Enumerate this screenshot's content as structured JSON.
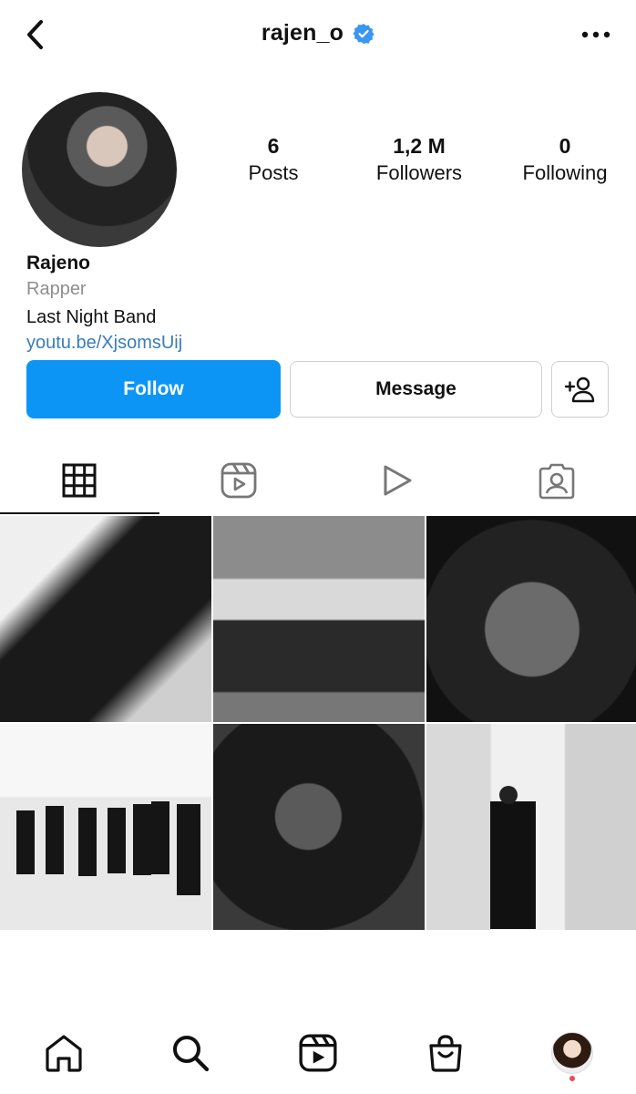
{
  "header": {
    "username": "rajen_o",
    "verified": true,
    "verified_color": "#3897f0"
  },
  "profile": {
    "stats": [
      {
        "key": "posts",
        "value": "6",
        "label": "Posts"
      },
      {
        "key": "followers",
        "value": "1,2 M",
        "label": "Followers"
      },
      {
        "key": "following",
        "value": "0",
        "label": "Following"
      }
    ],
    "name": "Rajeno",
    "category": "Rapper",
    "bio": "Last Night Band",
    "link": "youtu.be/XjsomsUij"
  },
  "actions": {
    "follow_label": "Follow",
    "message_label": "Message",
    "follow_color": "#0d95f5"
  },
  "tabs": [
    {
      "icon": "grid-icon",
      "active": true
    },
    {
      "icon": "reels-icon",
      "active": false
    },
    {
      "icon": "play-icon",
      "active": false
    },
    {
      "icon": "tagged-icon",
      "active": false
    }
  ],
  "posts": [
    {
      "icon": "photo"
    },
    {
      "icon": "photo"
    },
    {
      "icon": "photo"
    },
    {
      "icon": "photo"
    },
    {
      "icon": "photo"
    },
    {
      "icon": "photo"
    }
  ],
  "bottom_nav": [
    {
      "icon": "home-icon"
    },
    {
      "icon": "search-icon"
    },
    {
      "icon": "reels-icon"
    },
    {
      "icon": "shop-icon"
    },
    {
      "icon": "profile-avatar",
      "notification": true
    }
  ]
}
